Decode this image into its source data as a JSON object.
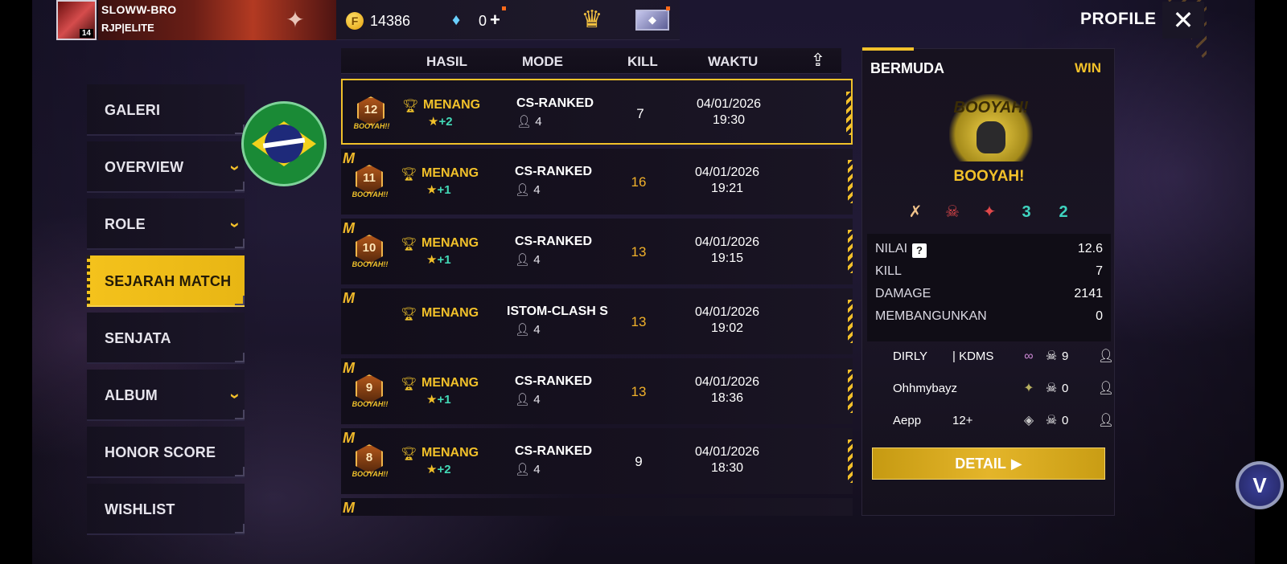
{
  "player": {
    "name": "SLOWW-BRO",
    "guild": "RJP|ELITE",
    "level": "14",
    "coins": "14386",
    "diamonds": "0",
    "plus": "+"
  },
  "header": {
    "profile": "PROFILE",
    "close": "✕"
  },
  "sidebar": {
    "items": [
      {
        "label": "GALERI",
        "chevron": false
      },
      {
        "label": "OVERVIEW",
        "chevron": true
      },
      {
        "label": "ROLE",
        "chevron": true
      },
      {
        "label": "SEJARAH MATCH",
        "chevron": false,
        "active": true
      },
      {
        "label": "SENJATA",
        "chevron": false
      },
      {
        "label": "ALBUM",
        "chevron": true
      },
      {
        "label": "HONOR SCORE",
        "chevron": false
      },
      {
        "label": "WISHLIST",
        "chevron": false
      }
    ]
  },
  "list_header": {
    "result": "HASIL",
    "mode": "MODE",
    "kill": "KILL",
    "time": "WAKTU"
  },
  "matches": [
    {
      "rank": "12",
      "booyah": "BOOYAH!!",
      "result": "MENANG",
      "stars": "+2",
      "mode": "CS-RANKED",
      "squad": "4",
      "kill": "7",
      "date": "04/01/2026",
      "time": "19:30",
      "selected": true,
      "mvp": false
    },
    {
      "rank": "11",
      "booyah": "BOOYAH!!",
      "result": "MENANG",
      "stars": "+1",
      "mode": "CS-RANKED",
      "squad": "4",
      "kill": "16",
      "date": "04/01/2026",
      "time": "19:21",
      "mvp": true
    },
    {
      "rank": "10",
      "booyah": "BOOYAH!!",
      "result": "MENANG",
      "stars": "+1",
      "mode": "CS-RANKED",
      "squad": "4",
      "kill": "13",
      "date": "04/01/2026",
      "time": "19:15",
      "mvp": true
    },
    {
      "rank": "",
      "booyah": "",
      "result": "MENANG",
      "stars": "",
      "mode": "ISTOM-CLASH SQ",
      "squad": "4",
      "kill": "13",
      "date": "04/01/2026",
      "time": "19:02",
      "mvp": true
    },
    {
      "rank": "9",
      "booyah": "BOOYAH!!",
      "result": "MENANG",
      "stars": "+1",
      "mode": "CS-RANKED",
      "squad": "4",
      "kill": "13",
      "date": "04/01/2026",
      "time": "18:36",
      "mvp": true
    },
    {
      "rank": "8",
      "booyah": "BOOYAH!!",
      "result": "MENANG",
      "stars": "+2",
      "mode": "CS-RANKED",
      "squad": "4",
      "kill": "9",
      "date": "04/01/2026",
      "time": "18:30",
      "mvp": true
    }
  ],
  "detail": {
    "map": "BERMUDA",
    "outcome": "WIN",
    "logo_text": "BOOYAH!",
    "title": "BOOYAH!",
    "badges": [
      "✗",
      "☠",
      "✦",
      "3",
      "2"
    ],
    "stats": [
      {
        "label": "NILAI",
        "value": "12.6",
        "help": "?"
      },
      {
        "label": "KILL",
        "value": "7"
      },
      {
        "label": "DAMAGE",
        "value": "2141"
      },
      {
        "label": "MEMBANGUNKAN",
        "value": "0"
      }
    ],
    "team": [
      {
        "name": "DIRLY",
        "tag": "|   KDMS",
        "kills": "9"
      },
      {
        "name": "Ohhmybayz",
        "tag": "",
        "kills": "0"
      },
      {
        "name": "Aepp",
        "tag": "12+",
        "kills": "0"
      }
    ],
    "button": "DETAIL"
  },
  "colors": {
    "accent": "#f2c12a",
    "active_tab": "#f4c21c",
    "kill_highlight": "#f1b12a",
    "star_plus": "#43d9b7"
  }
}
